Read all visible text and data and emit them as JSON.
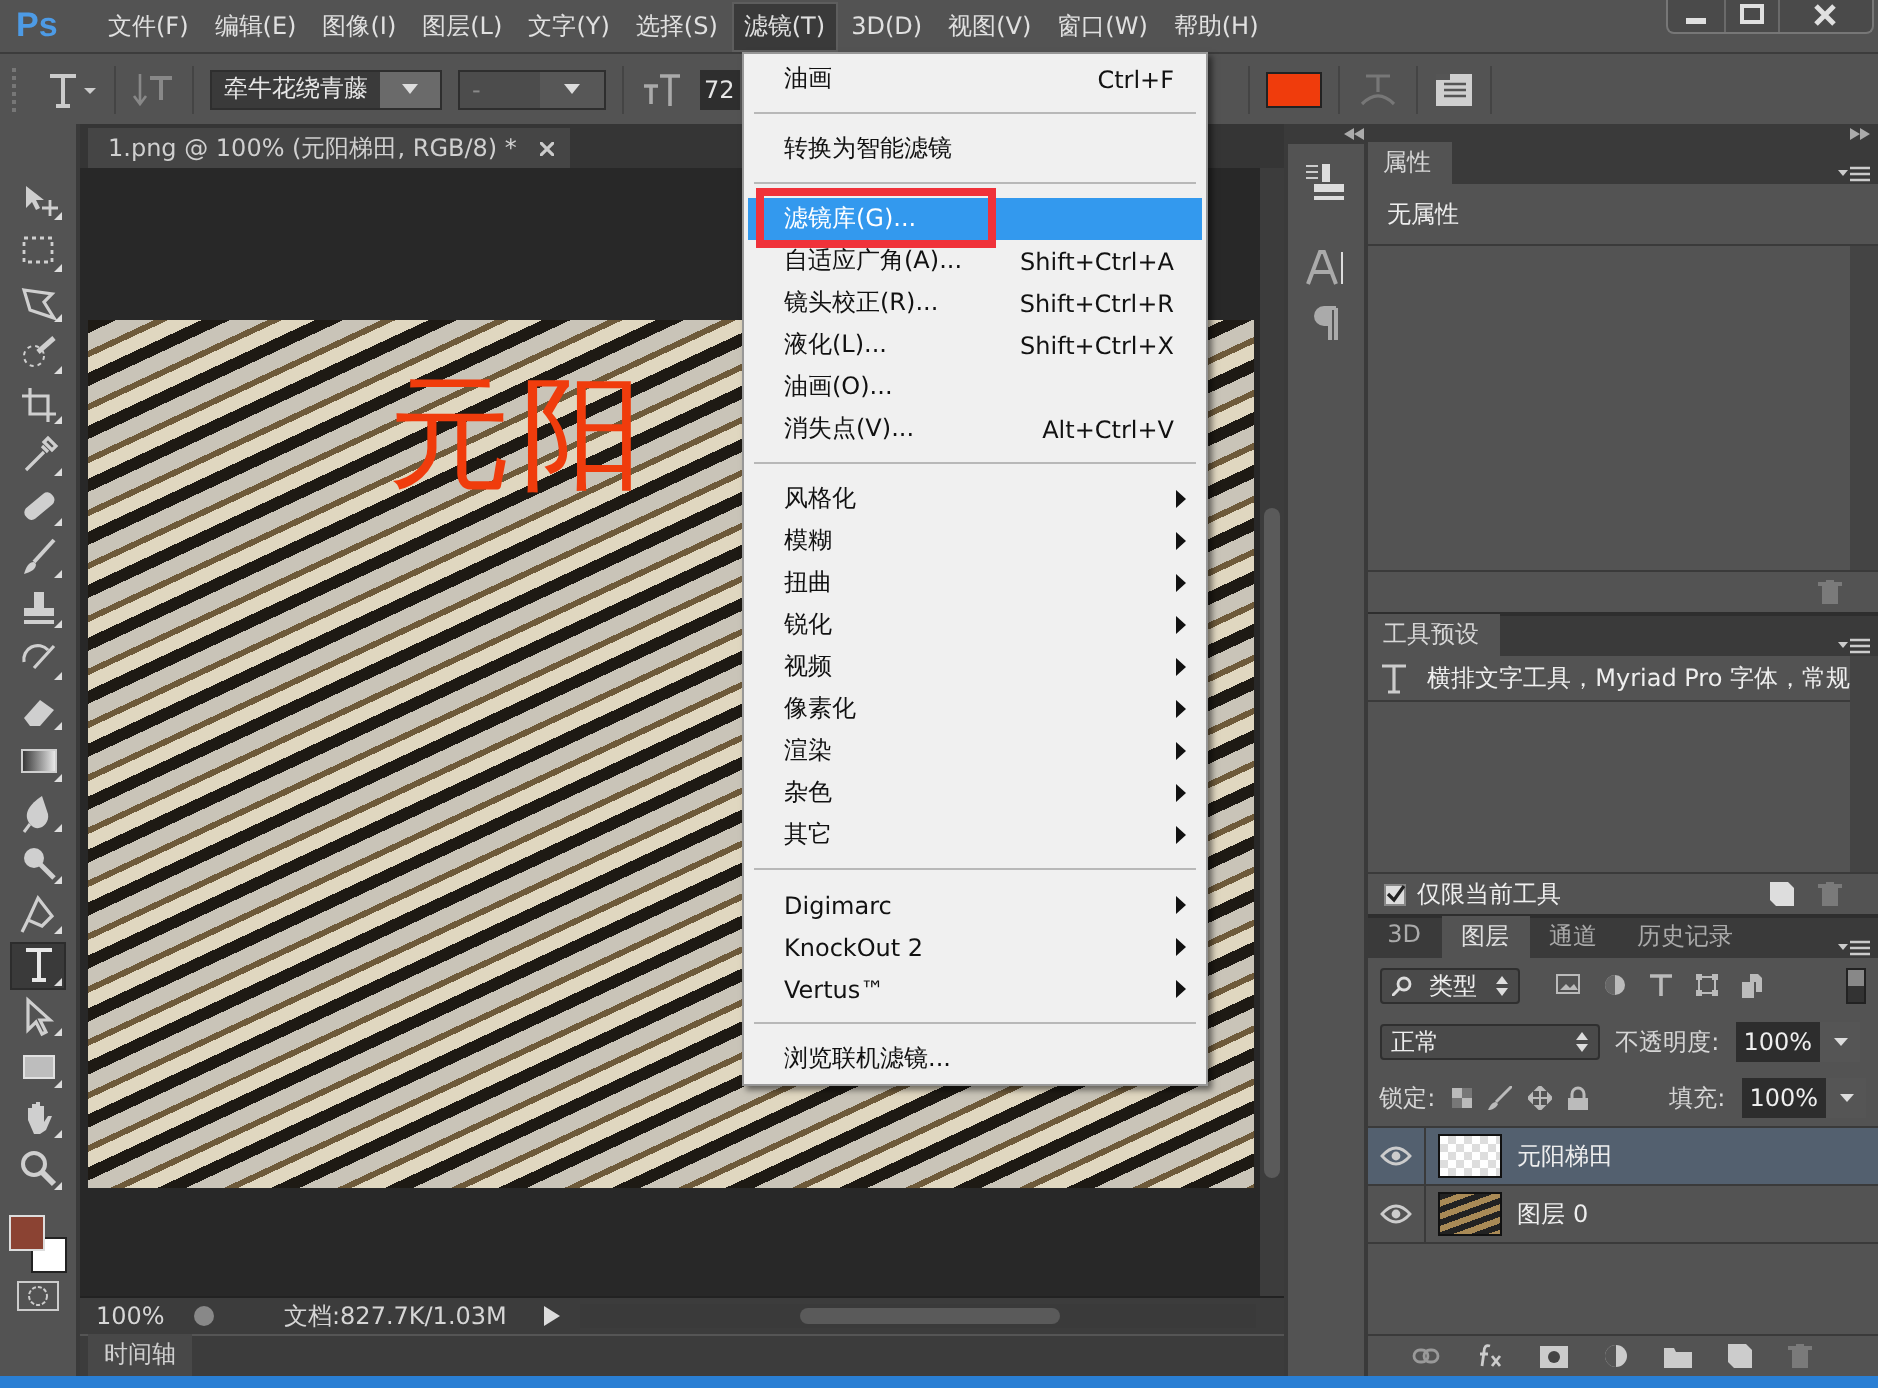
{
  "app": {
    "logo": "Ps"
  },
  "menubar": [
    {
      "label": "文件(F)",
      "selected": false
    },
    {
      "label": "编辑(E)",
      "selected": false
    },
    {
      "label": "图像(I)",
      "selected": false
    },
    {
      "label": "图层(L)",
      "selected": false
    },
    {
      "label": "文字(Y)",
      "selected": false
    },
    {
      "label": "选择(S)",
      "selected": false
    },
    {
      "label": "滤镜(T)",
      "selected": true
    },
    {
      "label": "3D(D)",
      "selected": false
    },
    {
      "label": "视图(V)",
      "selected": false
    },
    {
      "label": "窗口(W)",
      "selected": false
    },
    {
      "label": "帮助(H)",
      "selected": false
    }
  ],
  "options_bar": {
    "font_family": "牵牛花绕青藤",
    "font_style": "-",
    "font_size": "72"
  },
  "tools": [
    {
      "kind": "move",
      "selected": false
    },
    {
      "kind": "marquee",
      "selected": false
    },
    {
      "kind": "lasso",
      "selected": false
    },
    {
      "kind": "quick-select",
      "selected": false
    },
    {
      "kind": "crop",
      "selected": false
    },
    {
      "kind": "eyedropper",
      "selected": false
    },
    {
      "kind": "healing",
      "selected": false
    },
    {
      "kind": "brush",
      "selected": false
    },
    {
      "kind": "stamp",
      "selected": false
    },
    {
      "kind": "history-brush",
      "selected": false
    },
    {
      "kind": "eraser",
      "selected": false
    },
    {
      "kind": "gradient",
      "selected": false
    },
    {
      "kind": "blur",
      "selected": false
    },
    {
      "kind": "dodge",
      "selected": false
    },
    {
      "kind": "pen",
      "selected": false
    },
    {
      "kind": "type",
      "selected": true
    },
    {
      "kind": "path-select",
      "selected": false
    },
    {
      "kind": "rectangle",
      "selected": false
    },
    {
      "kind": "hand",
      "selected": false
    },
    {
      "kind": "zoom",
      "selected": false
    }
  ],
  "document": {
    "tab": "1.png @ 100% (元阳梯田, RGB/8) *",
    "canvas_text": "元阳"
  },
  "status_bar": {
    "zoom": "100%",
    "doc_info": "文档:827.7K/1.03M"
  },
  "timeline": {
    "tab": "时间轴"
  },
  "filter_menu": [
    {
      "kind": "item",
      "label": "油画",
      "shortcut": "Ctrl+F",
      "submenu": false,
      "selected": false
    },
    {
      "kind": "separator"
    },
    {
      "kind": "item",
      "label": "转换为智能滤镜",
      "submenu": false,
      "selected": false
    },
    {
      "kind": "separator"
    },
    {
      "kind": "item",
      "label": "滤镜库(G)...",
      "submenu": false,
      "selected": true
    },
    {
      "kind": "item",
      "label": "自适应广角(A)...",
      "shortcut": "Shift+Ctrl+A",
      "submenu": false,
      "selected": false
    },
    {
      "kind": "item",
      "label": "镜头校正(R)...",
      "shortcut": "Shift+Ctrl+R",
      "submenu": false,
      "selected": false
    },
    {
      "kind": "item",
      "label": "液化(L)...",
      "shortcut": "Shift+Ctrl+X",
      "submenu": false,
      "selected": false
    },
    {
      "kind": "item",
      "label": "油画(O)...",
      "submenu": false,
      "selected": false
    },
    {
      "kind": "item",
      "label": "消失点(V)...",
      "shortcut": "Alt+Ctrl+V",
      "submenu": false,
      "selected": false
    },
    {
      "kind": "separator"
    },
    {
      "kind": "item",
      "label": "风格化",
      "submenu": true,
      "selected": false
    },
    {
      "kind": "item",
      "label": "模糊",
      "submenu": true,
      "selected": false
    },
    {
      "kind": "item",
      "label": "扭曲",
      "submenu": true,
      "selected": false
    },
    {
      "kind": "item",
      "label": "锐化",
      "submenu": true,
      "selected": false
    },
    {
      "kind": "item",
      "label": "视频",
      "submenu": true,
      "selected": false
    },
    {
      "kind": "item",
      "label": "像素化",
      "submenu": true,
      "selected": false
    },
    {
      "kind": "item",
      "label": "渲染",
      "submenu": true,
      "selected": false
    },
    {
      "kind": "item",
      "label": "杂色",
      "submenu": true,
      "selected": false
    },
    {
      "kind": "item",
      "label": "其它",
      "submenu": true,
      "selected": false
    },
    {
      "kind": "separator"
    },
    {
      "kind": "item",
      "label": "Digimarc",
      "submenu": true,
      "selected": false
    },
    {
      "kind": "item",
      "label": "KnockOut 2",
      "submenu": true,
      "selected": false
    },
    {
      "kind": "item",
      "label": "Vertus™",
      "submenu": true,
      "selected": false
    },
    {
      "kind": "separator"
    },
    {
      "kind": "item",
      "label": "浏览联机滤镜...",
      "submenu": false,
      "selected": false
    }
  ],
  "properties_panel": {
    "tab": "属性",
    "message": "无属性"
  },
  "tool_presets_panel": {
    "tab": "工具预设",
    "preset": "横排文字工具，Myriad Pro 字体，常规",
    "current_tool_only": {
      "label": "仅限当前工具",
      "checked": true
    }
  },
  "layers_panel": {
    "tabs": [
      {
        "label": "3D",
        "selected": false
      },
      {
        "label": "图层",
        "selected": true
      },
      {
        "label": "通道",
        "selected": false
      },
      {
        "label": "历史记录",
        "selected": false
      }
    ],
    "filter_kind": "类型",
    "blend_mode": "正常",
    "opacity_label": "不透明度:",
    "opacity": "100%",
    "lock_label": "锁定:",
    "fill_label": "填充:",
    "fill": "100%",
    "layers": [
      {
        "name": "元阳梯田",
        "kind": "text",
        "visible": true,
        "selected": true
      },
      {
        "name": "图层 0",
        "kind": "image",
        "visible": true,
        "selected": false
      }
    ]
  }
}
